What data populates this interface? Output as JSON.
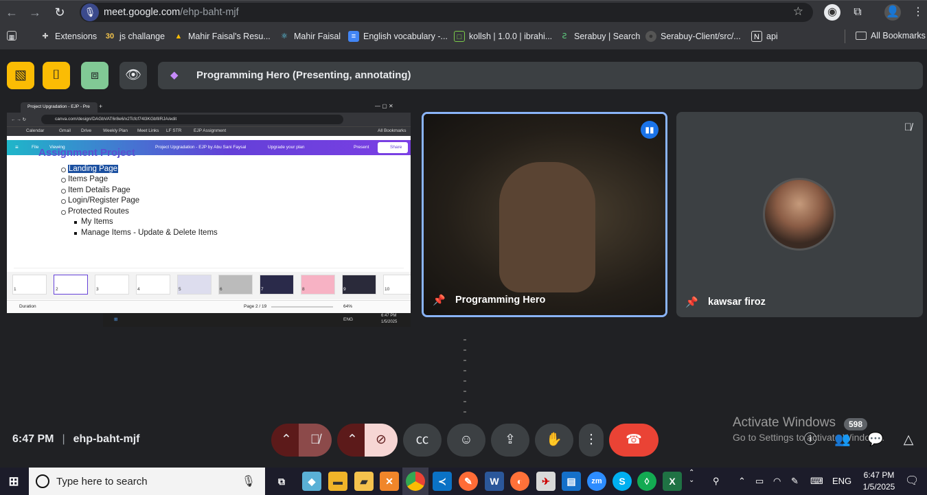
{
  "browser": {
    "url_domain": "meet.google.com",
    "url_path": "/ehp-baht-mjf",
    "bookmarks": [
      {
        "label": "Extensions",
        "icon": "puzzle-icon"
      },
      {
        "label": "js challange",
        "icon": "30"
      },
      {
        "label": "Mahir Faisal's Resu...",
        "icon": "drive-icon"
      },
      {
        "label": "Mahir Faisal",
        "icon": "react-icon"
      },
      {
        "label": "English vocabulary -...",
        "icon": "docs-icon"
      },
      {
        "label": "kollsh | 1.0.0 | ibrahi...",
        "icon": "vite-icon"
      },
      {
        "label": "Serabuy | Search",
        "icon": "serabuy-icon"
      },
      {
        "label": "Serabuy-Client/src/...",
        "icon": "github-icon"
      },
      {
        "label": "api",
        "icon": "notion-icon"
      }
    ],
    "all_bookmarks": "All Bookmarks"
  },
  "meet": {
    "presenting_banner": "Programming Hero (Presenting, annotating)",
    "tiles": [
      {
        "name": "Programming Hero"
      },
      {
        "name": "kawsar firoz"
      }
    ],
    "time": "6:47 PM",
    "meeting_code": "ehp-baht-mjf",
    "participant_count": "598"
  },
  "shared_screen": {
    "tab_title": "Project Upgradation - EJP - Pre",
    "url": "canva.com/design/DAGbVAT6r8e6/x2Tcfcf74l3KGbfiIRJA/edit",
    "bookmarks": [
      "Calendar",
      "Gmail",
      "Drive",
      "Weekly Plan",
      "Meet Links",
      "LF STR",
      "EJP Assignment",
      "All Bookmarks"
    ],
    "canva_menu": {
      "file": "File",
      "viewing": "Viewing",
      "doc_title": "Project Upgradation - EJP by Abu Sani Faysal",
      "upgrade": "Upgrade your plan",
      "present": "Present",
      "share": "Share"
    },
    "slide_heading": "Assignment Project",
    "items": [
      "Landing Page",
      "Items Page",
      "Item Details Page",
      "Login/Register Page",
      "Protected Routes"
    ],
    "sub_items": [
      "My Items",
      "Manage Items - Update & Delete Items"
    ],
    "duration": "Duration",
    "page": "Page 2 / 19",
    "zoom": "64%",
    "clock": "6:47 PM",
    "date": "1/5/2025",
    "lang": "ENG",
    "thumbs": [
      "1",
      "2",
      "3",
      "4",
      "5",
      "6",
      "7",
      "8",
      "9",
      "10"
    ]
  },
  "watermark": {
    "line1": "Activate Windows",
    "line2": "Go to Settings to activate Windows."
  },
  "taskbar": {
    "search_placeholder": "Type here to search",
    "lang": "ENG",
    "time": "6:47 PM",
    "date": "1/5/2025"
  }
}
